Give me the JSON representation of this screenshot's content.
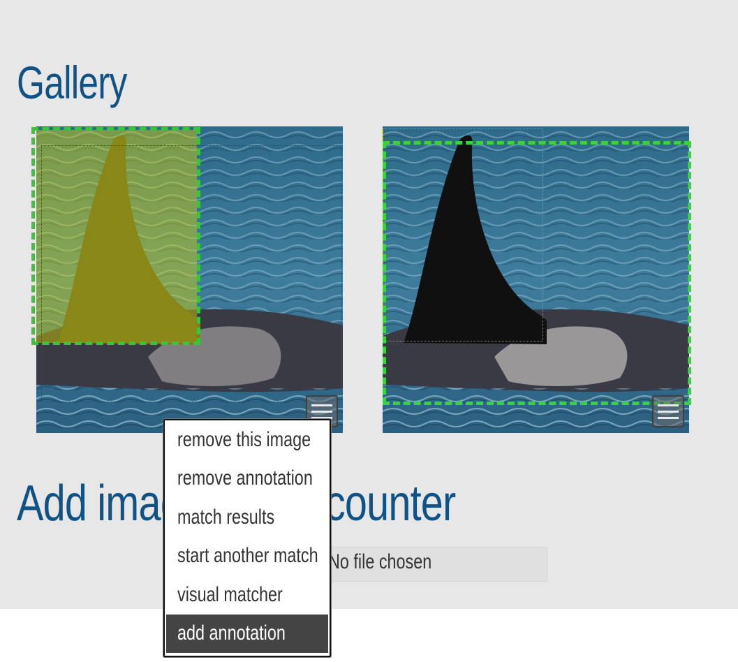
{
  "gallery": {
    "title": "Gallery",
    "images": [
      {
        "alt": "orca dorsal fin",
        "menu_icon": "hamburger-menu-icon"
      },
      {
        "alt": "orca dorsal fin",
        "menu_icon": "hamburger-menu-icon"
      }
    ]
  },
  "add_section": {
    "title": "Add images to Encounter",
    "file_status": "No file chosen"
  },
  "context_menu": {
    "items": [
      {
        "label": "remove this image",
        "active": false
      },
      {
        "label": "remove annotation",
        "active": false
      },
      {
        "label": "match results",
        "active": false
      },
      {
        "label": "start another match",
        "active": false
      },
      {
        "label": "visual matcher",
        "active": false
      },
      {
        "label": "add annotation",
        "active": true
      }
    ]
  },
  "colors": {
    "heading": "#0f5286",
    "panel_bg": "#e7e7e8",
    "annotation_dash": "#3ad33f",
    "highlight_fill": "#d4d000",
    "menu_active_bg": "#444444"
  }
}
